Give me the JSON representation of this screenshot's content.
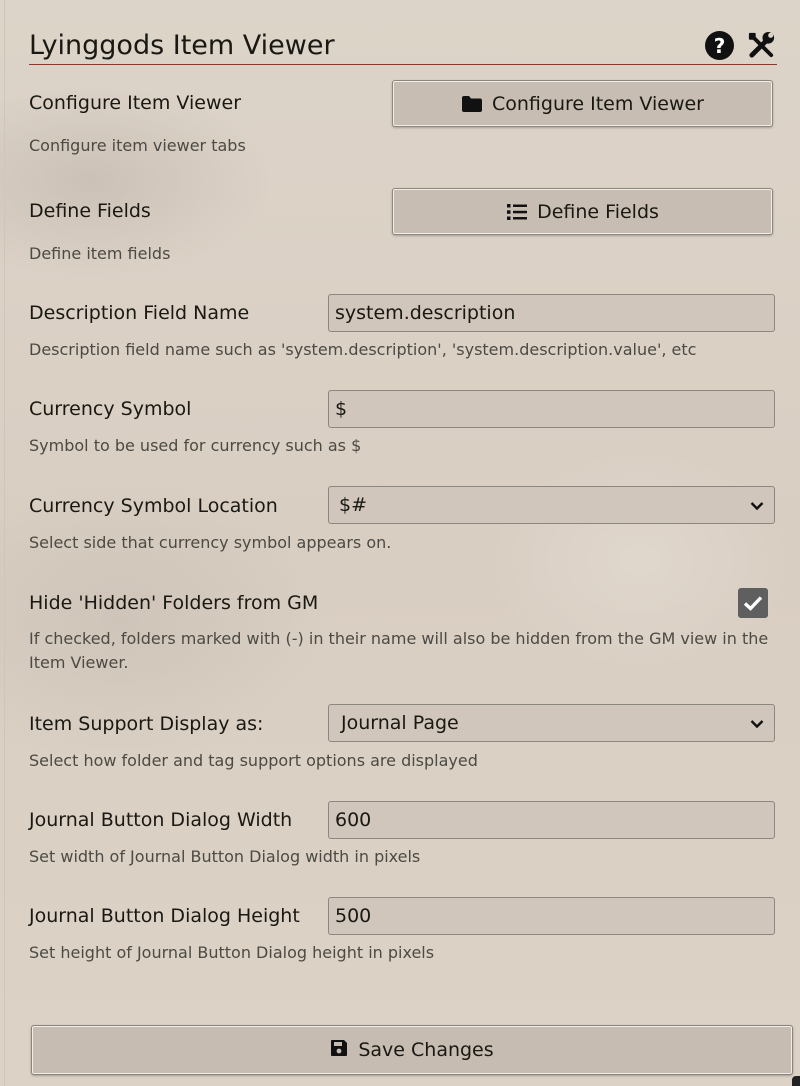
{
  "window": {
    "title": "Lyinggods Item Viewer",
    "help_icon": "question-circle-icon",
    "settings_icon": "tools-icon",
    "accent_color": "#8a3a2c"
  },
  "settings": {
    "configure": {
      "label": "Configure Item Viewer",
      "button_label": "Configure Item Viewer",
      "button_icon": "folder-icon",
      "hint": "Configure item viewer tabs"
    },
    "define_fields": {
      "label": "Define Fields",
      "button_label": "Define Fields",
      "button_icon": "list-icon",
      "hint": "Define item fields"
    },
    "description_field": {
      "label": "Description Field Name",
      "value": "system.description",
      "hint": "Description field name such as 'system.description', 'system.description.value', etc"
    },
    "currency_symbol": {
      "label": "Currency Symbol",
      "value": "$",
      "hint": "Symbol to be used for currency such as $"
    },
    "currency_location": {
      "label": "Currency Symbol Location",
      "value": "$#",
      "hint": "Select side that currency symbol appears on."
    },
    "hide_hidden": {
      "label": "Hide 'Hidden' Folders from GM",
      "checked": true,
      "hint": "If checked, folders marked with (-) in their name will also be hidden from the GM view in the Item Viewer."
    },
    "support_display": {
      "label": "Item Support Display as:",
      "value": "Journal Page",
      "hint": "Select how folder and tag support options are displayed"
    },
    "dialog_width": {
      "label": "Journal Button Dialog Width",
      "value": "600",
      "hint": "Set width of Journal Button Dialog width in pixels"
    },
    "dialog_height": {
      "label": "Journal Button Dialog Height",
      "value": "500",
      "hint": "Set height of Journal Button Dialog height in pixels"
    }
  },
  "footer": {
    "save_label": "Save Changes",
    "save_icon": "save-icon"
  }
}
